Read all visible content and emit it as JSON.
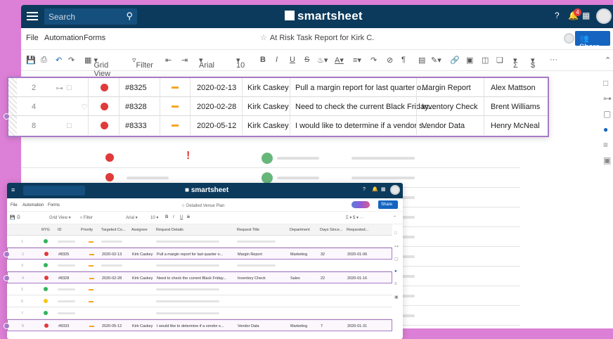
{
  "app": {
    "brand": "smartsheet",
    "search_placeholder": "Search",
    "notification_count": "4"
  },
  "menu": {
    "file": "File",
    "automation": "Automation",
    "forms": "Forms"
  },
  "sheet_title": "At Risk Task Report for Kirk C.",
  "share_label": "Share",
  "toolbar": {
    "grid_view": "Grid View",
    "filter": "Filter",
    "font": "Arial",
    "size": "10",
    "bold": "B",
    "italic": "I",
    "underline": "U",
    "strike": "S",
    "sigma": "Σ",
    "currency": "$",
    "more": "···"
  },
  "popup_rows": [
    {
      "row": "2",
      "id": "#8325",
      "date": "2020-02-13",
      "assignee": "Kirk Caskey",
      "details": "Pull a margin report for last quarter o...",
      "title": "Margin Report",
      "name": "Alex Mattson"
    },
    {
      "row": "4",
      "id": "#8328",
      "date": "2020-02-28",
      "assignee": "Kirk Caskey",
      "details": "Need to check the current Black Friday...",
      "title": "Inventory Check",
      "name": "Brent Williams"
    },
    {
      "row": "8",
      "id": "#8333",
      "date": "2020-05-12",
      "assignee": "Kirk Caskey",
      "details": "I would like to determine if a vendor s...",
      "title": "Vendor Data",
      "name": "Henry McNeal"
    }
  ],
  "small": {
    "brand": "smartsheet",
    "title": "Detailed Venue Plan",
    "share": "Share",
    "menu": {
      "file": "File",
      "automation": "Automation",
      "forms": "Forms"
    },
    "toolbar": {
      "grid_view": "Grid View",
      "filter": "Filter",
      "font": "Arial",
      "size": "10"
    },
    "headers": {
      "ryg": "RYG",
      "id": "ID",
      "priority": "Priority",
      "targeted": "Targeted Co...",
      "assignee": "Assignee",
      "details": "Request Details",
      "title": "Request Title",
      "department": "Department",
      "days": "Days Since...",
      "requested": "Requested..."
    },
    "rows": [
      {
        "n": "1",
        "color": "green"
      },
      {
        "n": "2",
        "color": "red",
        "id": "#8325",
        "date": "2020-02-13",
        "assignee": "Kirk Caskey",
        "details": "Pull a margin report for last quarter o...",
        "title": "Margin Report",
        "dept": "Marketing",
        "days": "32",
        "requested": "2020-01-06"
      },
      {
        "n": "3",
        "color": "green"
      },
      {
        "n": "4",
        "color": "red",
        "id": "#8328",
        "date": "2020-02-28",
        "assignee": "Kirk Caskey",
        "details": "Need to check the current Black Friday...",
        "title": "Inventory Check",
        "dept": "Sales",
        "days": "22",
        "requested": "2020-01-16"
      },
      {
        "n": "5",
        "color": "green"
      },
      {
        "n": "6",
        "color": "yellow"
      },
      {
        "n": "7",
        "color": "green"
      },
      {
        "n": "8",
        "color": "red",
        "id": "#8333",
        "date": "2020-05-12",
        "assignee": "Kirk Caskey",
        "details": "I would like to determine if a vendor s...",
        "title": "Vendor Data",
        "dept": "Marketing",
        "days": "7",
        "requested": "2020-01-31"
      }
    ]
  },
  "colors": {
    "topbar": "#0c3a5c",
    "accent": "#a77ac7",
    "red": "#e03a3a",
    "green": "#2fb45a",
    "yellow": "#f5c518",
    "orange": "#f5a623"
  }
}
